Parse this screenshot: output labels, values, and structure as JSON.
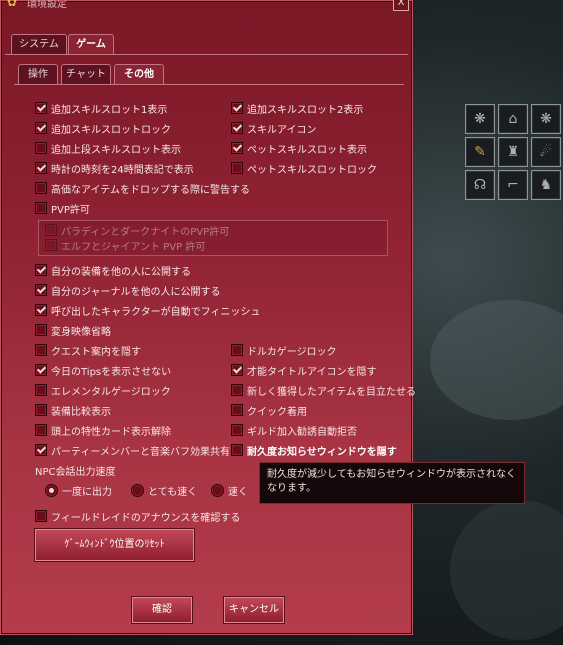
{
  "window": {
    "title": "環境設定",
    "close_label": "X"
  },
  "main_tabs": [
    {
      "label": "システム"
    },
    {
      "label": "ゲーム"
    }
  ],
  "sub_tabs": [
    {
      "label": "操作"
    },
    {
      "label": "チャット"
    },
    {
      "label": "その他"
    }
  ],
  "options": {
    "slot1": "追加スキルスロット1表示",
    "slot2": "追加スキルスロット2表示",
    "slot_lock": "追加スキルスロットロック",
    "skill_icon": "スキルアイコン",
    "upper_slot": "追加上段スキルスロット表示",
    "pet_slot": "ペットスキルスロット表示",
    "clock24": "時計の時刻を24時間表記で表示",
    "pet_lock": "ペットスキルスロットロック",
    "drop_warn": "高価なアイテムをドロップする際に警告する",
    "pvp": "PVP許可",
    "pvp_paladin": "パラディンとダークナイトのPVP許可",
    "pvp_elf": "エルフとジャイアント PVP 許可",
    "share_equip": "自分の装備を他の人に公開する",
    "share_journal": "自分のジャーナルを他の人に公開する",
    "auto_finish": "呼び出したキャラクターが自動でフィニッシュ",
    "transform_skip": "変身映像省略",
    "hide_quest": "クエスト案内を隠す",
    "dorka_lock": "ドルカゲージロック",
    "hide_tips": "今日のTipsを表示させない",
    "hide_title": "才能タイトルアイコンを隠す",
    "elemental_lock": "エレメンタルゲージロック",
    "highlight_new": "新しく獲得したアイテムを目立たせる",
    "equip_compare": "装備比較表示",
    "quick_equip": "クイック着用",
    "card_off": "頭上の特性カード表示解除",
    "guild_refuse": "ギルド加入勧誘自動拒否",
    "party_buff": "パーティーメンバーと音楽バフ効果共有",
    "durability": "耐久度お知らせウィンドウを隠す",
    "field_raid": "フィールドレイドのアナウンスを確認する"
  },
  "npc_speed": {
    "label": "NPC会話出力速度",
    "options": [
      "一度に出力",
      "とても速く",
      "速く"
    ]
  },
  "reset_button": "ｹﾞｰﾑｳｨﾝﾄﾞｳ位置のﾘｾｯﾄ",
  "ok_button": "確認",
  "cancel_button": "キャンセル",
  "tooltip": "耐久度が減少してもお知らせウィンドウが表示されなくなります。",
  "equip_slots": [
    {
      "icon": "wing-icon"
    },
    {
      "icon": "house-icon"
    },
    {
      "icon": "wing-icon"
    },
    {
      "icon": "brush-icon"
    },
    {
      "icon": "shirt-icon"
    },
    {
      "icon": "glove-icon"
    },
    {
      "icon": "shoe-icon"
    },
    {
      "icon": "boot-icon"
    },
    {
      "icon": "armor-icon"
    }
  ]
}
